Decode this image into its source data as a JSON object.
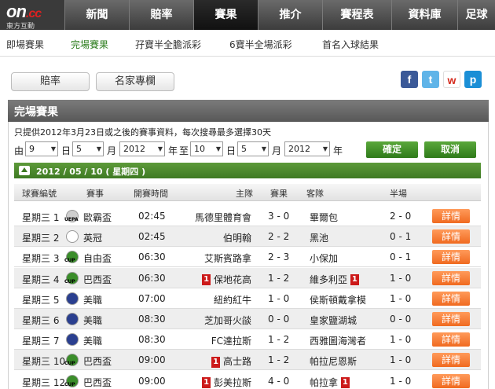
{
  "logo": {
    "main": "on",
    "suffix": ".cc",
    "sub": "東方互動"
  },
  "nav": [
    "新聞",
    "賠率",
    "賽果",
    "推介",
    "賽程表",
    "資料庫",
    "足球"
  ],
  "subnav": [
    "即場賽果",
    "完場賽果",
    "孖寶半全膽派彩",
    "6寶半全場派彩",
    "首名入球結果"
  ],
  "tabs": {
    "odds": "賠率",
    "columnists": "名家專欄"
  },
  "panel_title": "完場賽果",
  "notice": "只提供2012年3月23日或之後的賽事資料，每次搜尋最多選擇30天",
  "date_filter": {
    "from_label": "由",
    "to_label": "至",
    "day_label": "日",
    "month_label": "月",
    "year_label": "年",
    "from": {
      "day": "9",
      "month": "5",
      "year": "2012"
    },
    "to": {
      "day": "10",
      "month": "5",
      "year": "2012"
    },
    "confirm": "確定",
    "cancel": "取消"
  },
  "date_band": "2012 / 05 / 10 ( 星期四 )",
  "columns": [
    "球賽編號",
    "賽事",
    "開賽時間",
    "主隊",
    "賽果",
    "客隊",
    "半場"
  ],
  "detail_label": "詳情",
  "matches": [
    {
      "id": "星期三 1",
      "league": "歐霸盃",
      "icon": "UEPA",
      "time": "02:45",
      "home": "馬德里體育會",
      "home_card": "",
      "score": "3 - 0",
      "away": "畢爾包",
      "away_card": "",
      "half": "2 - 0"
    },
    {
      "id": "星期三 2",
      "league": "英冠",
      "icon": "",
      "time": "02:45",
      "home": "伯明翰",
      "home_card": "",
      "score": "2 - 2",
      "away": "黑池",
      "away_card": "",
      "half": "0 - 1"
    },
    {
      "id": "星期三 3",
      "league": "自由盃",
      "icon": "CUP",
      "time": "06:30",
      "home": "艾斯賓路拿",
      "home_card": "",
      "score": "2 - 3",
      "away": "小保加",
      "away_card": "",
      "half": "0 - 1"
    },
    {
      "id": "星期三 4",
      "league": "巴西盃",
      "icon": "CUP",
      "time": "06:30",
      "home": "保地花高",
      "home_card": "1",
      "score": "1 - 2",
      "away": "維多利亞",
      "away_card": "1",
      "half": "1 - 0"
    },
    {
      "id": "星期三 5",
      "league": "美職",
      "icon": "",
      "time": "07:00",
      "home": "紐約紅牛",
      "home_card": "",
      "score": "1 - 0",
      "away": "侯斯頓戴拿模",
      "away_card": "",
      "half": "1 - 0"
    },
    {
      "id": "星期三 6",
      "league": "美職",
      "icon": "",
      "time": "08:30",
      "home": "芝加哥火燄",
      "home_card": "",
      "score": "0 - 0",
      "away": "皇家鹽湖城",
      "away_card": "",
      "half": "0 - 0"
    },
    {
      "id": "星期三 7",
      "league": "美職",
      "icon": "",
      "time": "08:30",
      "home": "FC達拉斯",
      "home_card": "",
      "score": "1 - 2",
      "away": "西雅圖海灣者",
      "away_card": "",
      "half": "1 - 0"
    },
    {
      "id": "星期三 10",
      "league": "巴西盃",
      "icon": "CUP",
      "time": "09:00",
      "home": "高士路",
      "home_card": "1",
      "score": "1 - 2",
      "away": "帕拉尼恩斯",
      "away_card": "",
      "half": "1 - 0"
    },
    {
      "id": "星期三 12",
      "league": "巴西盃",
      "icon": "CUP",
      "time": "09:00",
      "home": "彭美拉斯",
      "home_card": "1",
      "score": "4 - 0",
      "away": "帕拉拿",
      "away_card": "1",
      "half": "1 - 0"
    }
  ],
  "share_icons": [
    "facebook-icon",
    "twitter-icon",
    "weibo-icon",
    "plurk-icon"
  ],
  "colors": {
    "accent_green": "#3e7a22",
    "detail_orange": "#f06a20",
    "card_red": "#cc1a1a"
  }
}
